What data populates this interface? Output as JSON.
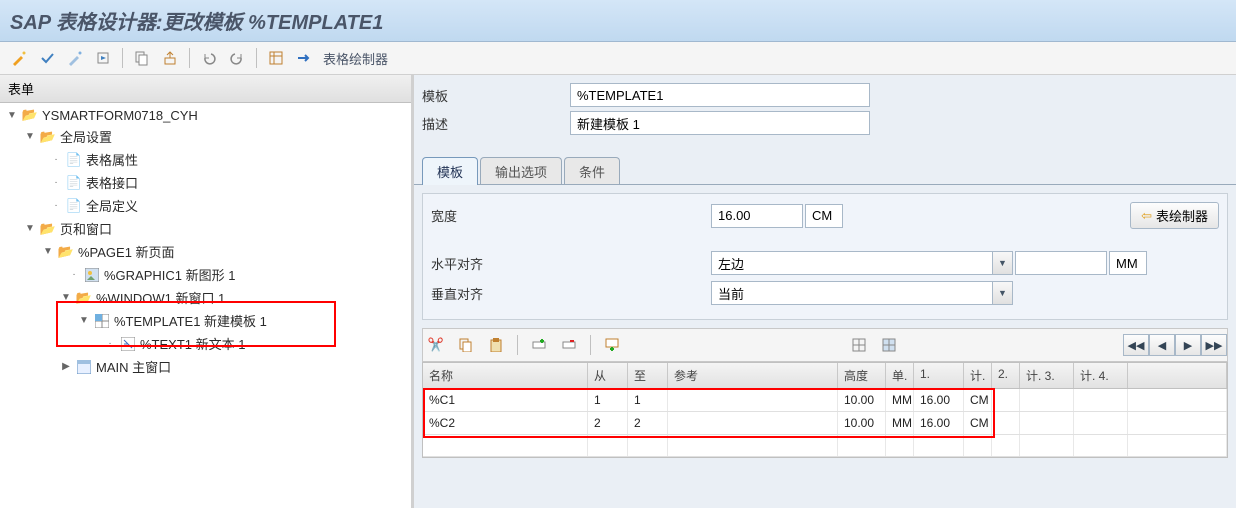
{
  "title": "SAP 表格设计器:更改模板 %TEMPLATE1",
  "toolbar_link": "表格绘制器",
  "tree_header": "表单",
  "tree": {
    "root": "YSMARTFORM0718_CYH",
    "global": "全局设置",
    "attr": "表格属性",
    "iface": "表格接口",
    "def": "全局定义",
    "pages": "页和窗口",
    "page1": "%PAGE1 新页面",
    "graphic1": "%GRAPHIC1 新图形 1",
    "window1": "%WINDOW1 新窗口 1",
    "template1": "%TEMPLATE1 新建模板 1",
    "text1": "%TEXT1 新文本 1",
    "main": "MAIN 主窗口"
  },
  "fields": {
    "template_label": "模板",
    "template_value": "%TEMPLATE1",
    "desc_label": "描述",
    "desc_value": "新建模板 1"
  },
  "tabs": {
    "template": "模板",
    "output": "输出选项",
    "condition": "条件"
  },
  "form": {
    "width_label": "宽度",
    "width_value": "16.00",
    "width_unit": "CM",
    "halign_label": "水平对齐",
    "halign_value": "左边",
    "halign_side_unit": "MM",
    "valign_label": "垂直对齐",
    "valign_value": "当前",
    "painter_btn": "表绘制器"
  },
  "grid": {
    "headers": {
      "name": "名称",
      "from": "从",
      "to": "至",
      "ref": "参考",
      "height": "高度",
      "u1": "单.",
      "m1": "1.",
      "u2": "计.",
      "c2": "2.",
      "c3": "计. 3.",
      "c4": "计. 4."
    },
    "rows": [
      {
        "name": "%C1",
        "from": "1",
        "to": "1",
        "ref": "",
        "h": "10.00",
        "u1": "MM",
        "m1": "16.00",
        "u2": "CM"
      },
      {
        "name": "%C2",
        "from": "2",
        "to": "2",
        "ref": "",
        "h": "10.00",
        "u1": "MM",
        "m1": "16.00",
        "u2": "CM"
      }
    ]
  }
}
